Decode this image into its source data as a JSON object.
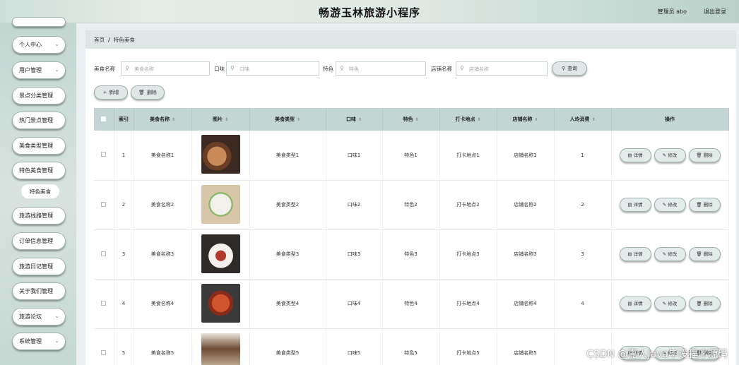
{
  "header": {
    "title": "畅游玉林旅游小程序",
    "user": "管理员 abo",
    "logout": "退出登录"
  },
  "sidebar": {
    "items": [
      {
        "label": "个人中心",
        "chevron": true
      },
      {
        "label": "用户管理",
        "chevron": true
      },
      {
        "label": "景点分类管理",
        "chevron": false
      },
      {
        "label": "热门景点管理",
        "chevron": false
      },
      {
        "label": "美食类型管理",
        "chevron": false
      },
      {
        "label": "特色美食管理",
        "chevron": false
      },
      {
        "label": "旅游线路管理",
        "chevron": false
      },
      {
        "label": "订单信息管理",
        "chevron": false
      },
      {
        "label": "旅游日记管理",
        "chevron": false
      },
      {
        "label": "关于我们管理",
        "chevron": false
      },
      {
        "label": "旅游论坛",
        "chevron": true
      },
      {
        "label": "系统管理",
        "chevron": true
      }
    ],
    "subitem": "特色美食"
  },
  "breadcrumb": {
    "home": "首页",
    "sep": "/",
    "current": "特色美食"
  },
  "search": {
    "food_name_label": "美食名称",
    "food_name_placeholder": "美食名称",
    "taste_label": "口味",
    "taste_placeholder": "口味",
    "feature_label": "特色",
    "feature_placeholder": "特色",
    "shop_label": "店铺名称",
    "shop_placeholder": "店铺名称",
    "query_button": "查询"
  },
  "actions": {
    "add": "新增",
    "delete": "删除"
  },
  "table": {
    "headers": [
      "索引",
      "美食名称",
      "图片",
      "美食类型",
      "口味",
      "特色",
      "打卡地点",
      "店铺名称",
      "人均消费",
      "操作"
    ],
    "op_labels": {
      "detail": "详情",
      "edit": "修改",
      "delete": "删除"
    },
    "rows": [
      {
        "index": "1",
        "name": "美食名称1",
        "type": "美食类型1",
        "taste": "口味1",
        "feature": "特色1",
        "location": "打卡地点1",
        "shop": "店铺名称1",
        "avg": "1"
      },
      {
        "index": "2",
        "name": "美食名称2",
        "type": "美食类型2",
        "taste": "口味2",
        "feature": "特色2",
        "location": "打卡地点2",
        "shop": "店铺名称2",
        "avg": "2"
      },
      {
        "index": "3",
        "name": "美食名称3",
        "type": "美食类型3",
        "taste": "口味3",
        "feature": "特色3",
        "location": "打卡地点3",
        "shop": "店铺名称3",
        "avg": "3"
      },
      {
        "index": "4",
        "name": "美食名称4",
        "type": "美食类型4",
        "taste": "口味4",
        "feature": "特色4",
        "location": "打卡地点4",
        "shop": "店铺名称4",
        "avg": "4"
      },
      {
        "index": "5",
        "name": "美食名称5",
        "type": "美食类型5",
        "taste": "口味5",
        "feature": "特色5",
        "location": "打卡地点5",
        "shop": "店铺名称5",
        "avg": ""
      }
    ]
  },
  "watermark": "CSDN @嘉人Java毕设程序源码",
  "colors": {
    "accent": "#c3d6d4",
    "sidebar": "#c6d8d2",
    "button": "#dfe8e7"
  }
}
